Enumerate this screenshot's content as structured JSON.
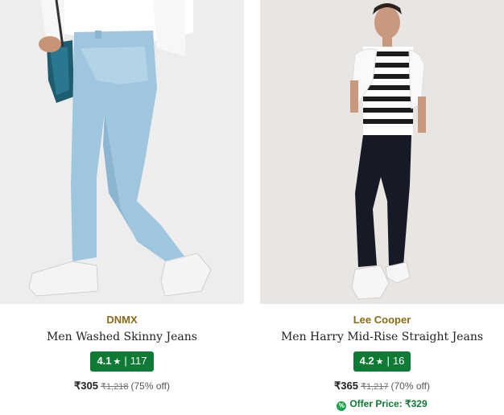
{
  "products": [
    {
      "brand": "DNMX",
      "title": "Men Washed Skinny Jeans",
      "rating": "4.1",
      "rating_count": "117",
      "price": "₹305",
      "mrp": "₹1,218",
      "discount": "(75% off)",
      "offer_price": ""
    },
    {
      "brand": "Lee Cooper",
      "title": "Men Harry Mid-Rise Straight Jeans",
      "rating": "4.2",
      "rating_count": "16",
      "price": "₹365",
      "mrp": "₹1,217",
      "discount": "(70% off)",
      "offer_price": "Offer Price: ₹329"
    }
  ],
  "colors": {
    "brand_text": "#8a6a16",
    "rating_badge": "#0f7a34",
    "offer_text": "#0f7a34"
  },
  "icons": {
    "rating": "star-icon",
    "offer": "offer-tag-icon"
  }
}
